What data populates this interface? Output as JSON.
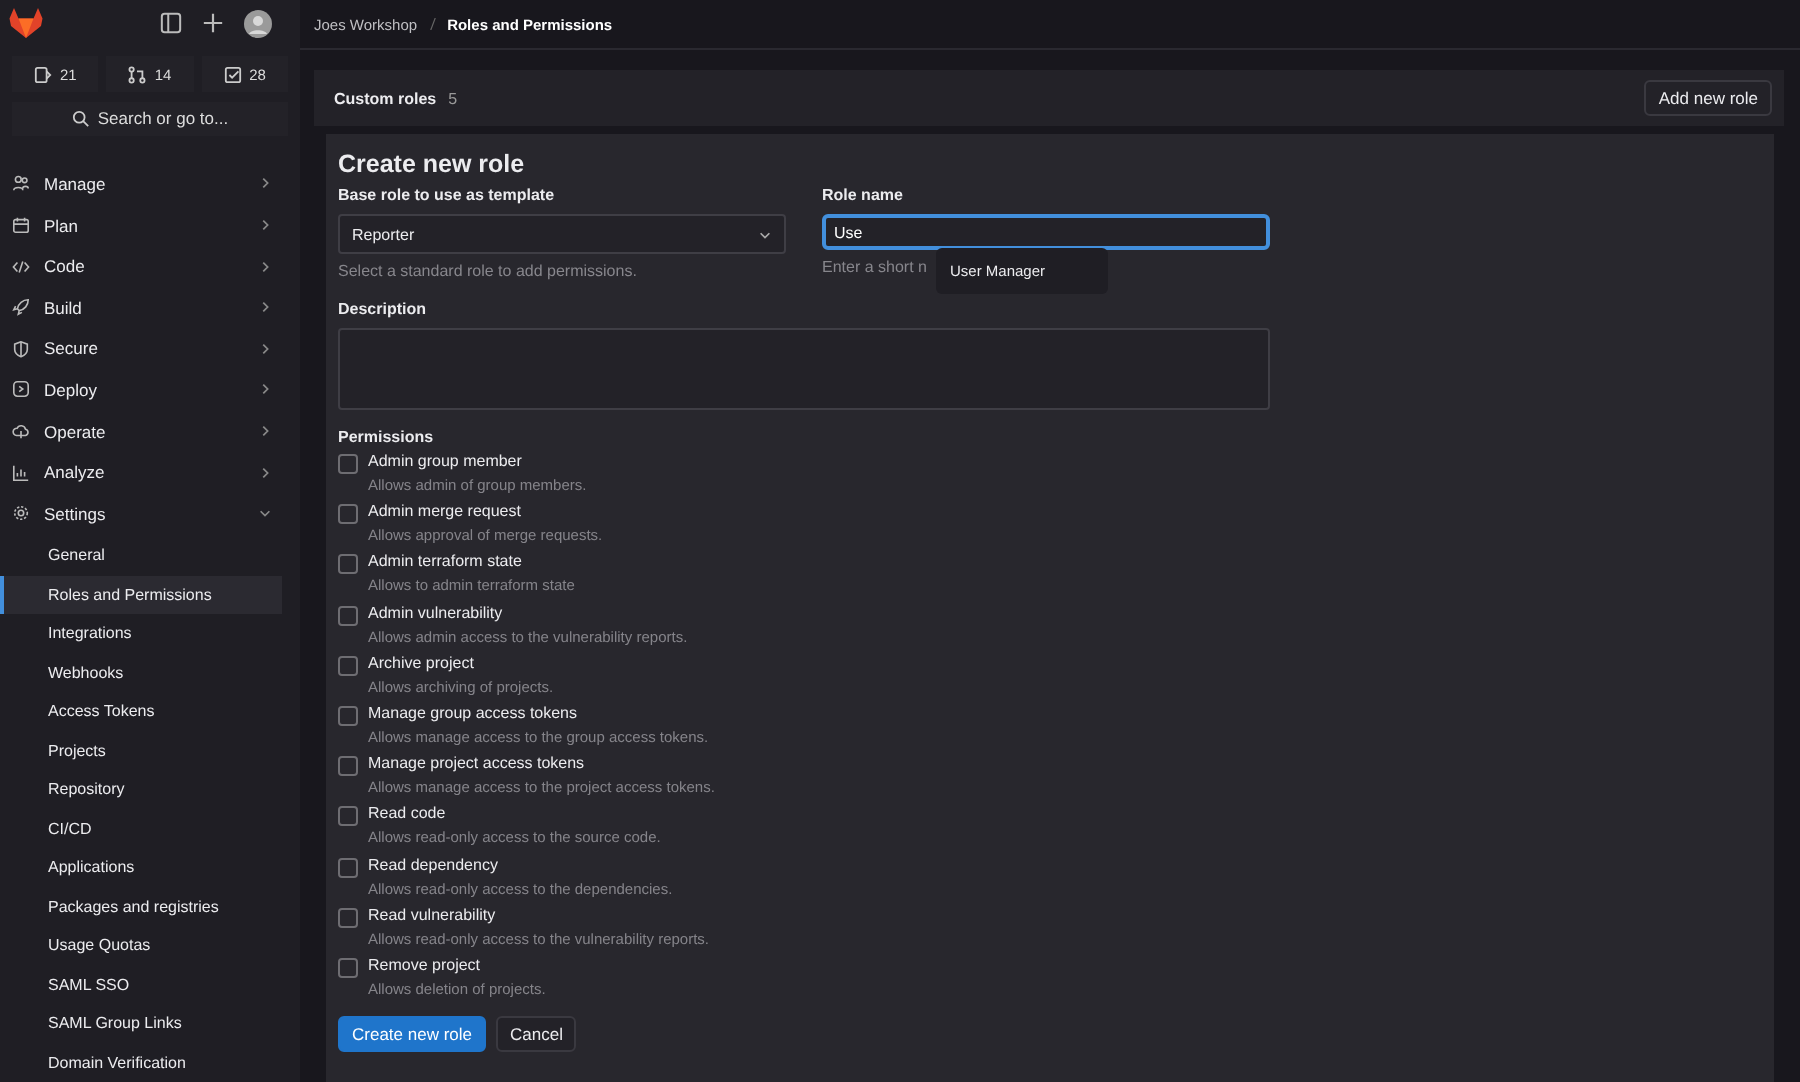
{
  "sidebar": {
    "counts": [
      {
        "kind": "issues",
        "value": "21"
      },
      {
        "kind": "merge-requests",
        "value": "14"
      },
      {
        "kind": "todos",
        "value": "28"
      }
    ],
    "search": {
      "placeholder": "Search or go to..."
    },
    "items": [
      {
        "label": "Manage",
        "kind": "people",
        "expanded": false
      },
      {
        "label": "Plan",
        "kind": "calendar",
        "expanded": false
      },
      {
        "label": "Code",
        "kind": "code",
        "expanded": false
      },
      {
        "label": "Build",
        "kind": "rocket",
        "expanded": false
      },
      {
        "label": "Secure",
        "kind": "shield",
        "expanded": false
      },
      {
        "label": "Deploy",
        "kind": "deploy",
        "expanded": false
      },
      {
        "label": "Operate",
        "kind": "cloud",
        "expanded": false
      },
      {
        "label": "Analyze",
        "kind": "chart",
        "expanded": false
      },
      {
        "label": "Settings",
        "kind": "gear",
        "expanded": true,
        "children": [
          {
            "label": "General",
            "selected": false
          },
          {
            "label": "Roles and Permissions",
            "selected": true
          },
          {
            "label": "Integrations",
            "selected": false
          },
          {
            "label": "Webhooks",
            "selected": false
          },
          {
            "label": "Access Tokens",
            "selected": false
          },
          {
            "label": "Projects",
            "selected": false
          },
          {
            "label": "Repository",
            "selected": false
          },
          {
            "label": "CI/CD",
            "selected": false
          },
          {
            "label": "Applications",
            "selected": false
          },
          {
            "label": "Packages and registries",
            "selected": false
          },
          {
            "label": "Usage Quotas",
            "selected": false
          },
          {
            "label": "SAML SSO",
            "selected": false
          },
          {
            "label": "SAML Group Links",
            "selected": false
          },
          {
            "label": "Domain Verification",
            "selected": false
          }
        ]
      }
    ]
  },
  "breadcrumb": [
    "Joes Workshop",
    "Roles and Permissions"
  ],
  "custom_roles": {
    "title": "Custom roles",
    "count": "5",
    "button": "Add new role"
  },
  "form": {
    "title": "Create new role",
    "base_role": {
      "label": "Base role to use as template",
      "value": "Reporter",
      "help": "Select a standard role to add permissions."
    },
    "role_name": {
      "label": "Role name",
      "value": "Use",
      "help": "Enter a short n",
      "suggestion": "User Manager"
    },
    "description": {
      "label": "Description"
    },
    "permissions_label": "Permissions",
    "permissions": [
      {
        "name": "Admin group member",
        "description": "Allows admin of group members.",
        "checked": false
      },
      {
        "name": "Admin merge request",
        "description": "Allows approval of merge requests.",
        "checked": false
      },
      {
        "name": "Admin terraform state",
        "description": "Allows to admin terraform state",
        "checked": false
      },
      {
        "name": "Admin vulnerability",
        "description": "Allows admin access to the vulnerability reports.",
        "checked": false
      },
      {
        "name": "Archive project",
        "description": "Allows archiving of projects.",
        "checked": false
      },
      {
        "name": "Manage group access tokens",
        "description": "Allows manage access to the group access tokens.",
        "checked": false
      },
      {
        "name": "Manage project access tokens",
        "description": "Allows manage access to the project access tokens.",
        "checked": false
      },
      {
        "name": "Read code",
        "description": "Allows read-only access to the source code.",
        "checked": false
      },
      {
        "name": "Read dependency",
        "description": "Allows read-only access to the dependencies.",
        "checked": false
      },
      {
        "name": "Read vulnerability",
        "description": "Allows read-only access to the vulnerability reports.",
        "checked": false
      },
      {
        "name": "Remove project",
        "description": "Allows deletion of projects.",
        "checked": false
      }
    ],
    "buttons": [
      {
        "label": "Create new role",
        "kind": "primary"
      },
      {
        "label": "Cancel",
        "kind": "secondary"
      }
    ]
  }
}
